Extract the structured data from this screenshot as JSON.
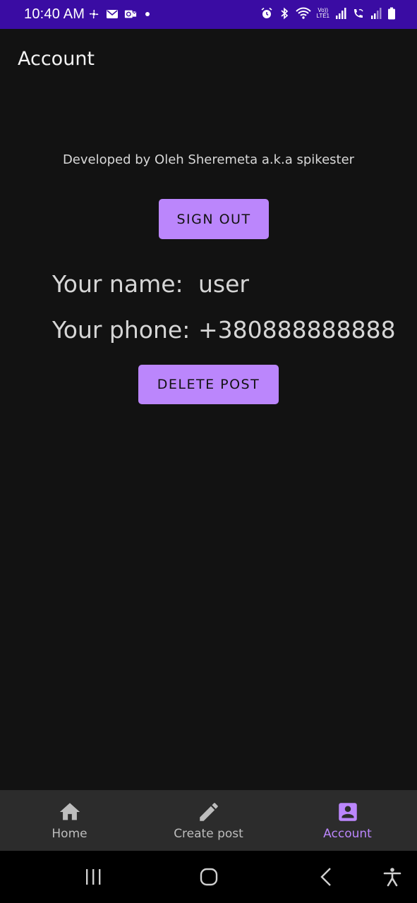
{
  "status_bar": {
    "time": "10:40 AM",
    "lte_label_top": "Vo))",
    "lte_label_bottom": "LTE1",
    "icons_left": [
      "fan-icon",
      "mail-icon",
      "outlook-icon",
      "notification-dot-icon"
    ],
    "icons_right": [
      "alarm-icon",
      "bluetooth-icon",
      "wifi-icon",
      "volte-icon",
      "signal-icon",
      "wifi-calling-icon",
      "signal-2-icon",
      "battery-icon"
    ]
  },
  "app_bar": {
    "title": "Account"
  },
  "credit": "Developed by Oleh Sheremeta a.k.a spikester",
  "buttons": {
    "sign_out": "SIGN OUT",
    "delete_post": "DELETE POST"
  },
  "profile": {
    "name_label": "Your name:",
    "name_value": "user",
    "phone_label": "Your phone:",
    "phone_value": "+380888888888"
  },
  "bottom_nav": {
    "items": [
      {
        "label": "Home",
        "icon": "home-icon",
        "active": false
      },
      {
        "label": "Create post",
        "icon": "pencil-icon",
        "active": false
      },
      {
        "label": "Account",
        "icon": "account-box-icon",
        "active": true
      }
    ]
  },
  "system_nav": [
    "recents-icon",
    "home-circle-icon",
    "back-icon",
    "accessibility-icon"
  ],
  "colors": {
    "status_bar": "#3a0ca3",
    "background": "#121212",
    "accent": "#bb86fc",
    "bottom_nav": "#2c2c2c"
  }
}
